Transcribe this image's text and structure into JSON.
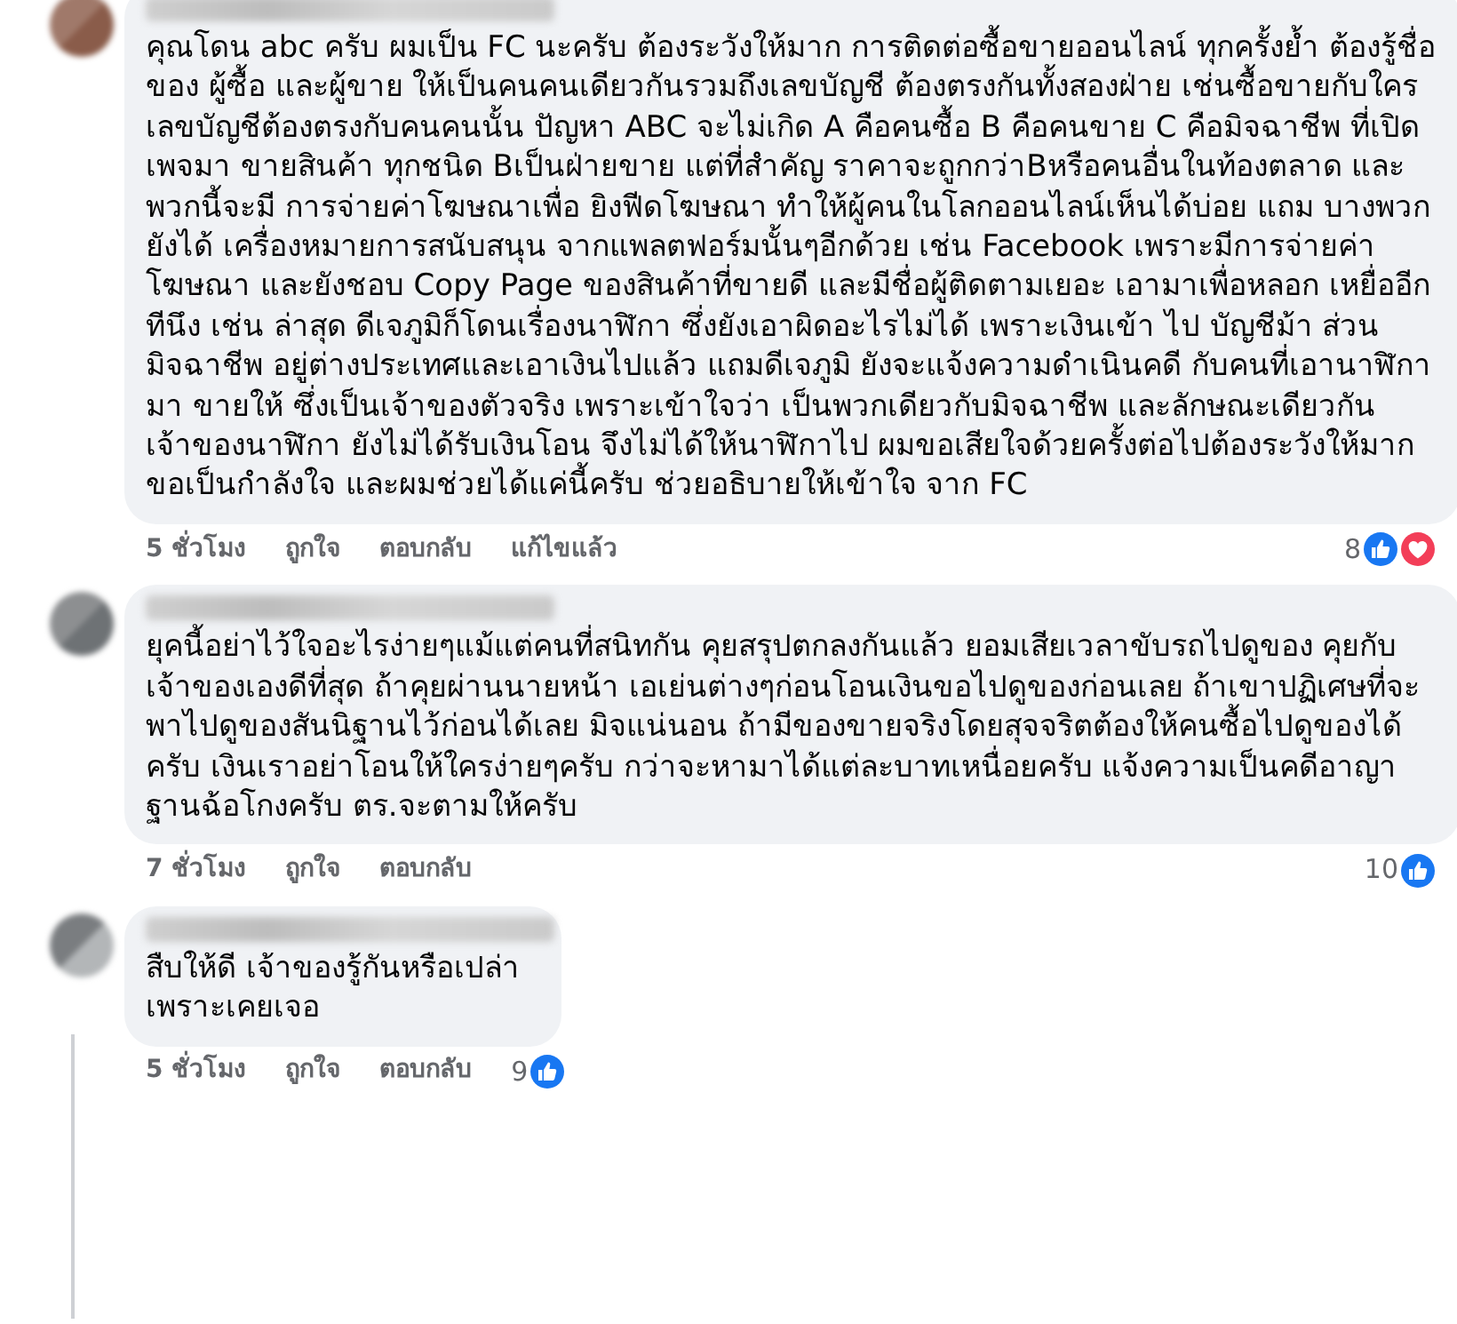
{
  "comments": [
    {
      "reply": false,
      "text": "คุณโดน abc ครับ ผมเป็น FC นะครับ ต้องระวังให้มาก การติดต่อซื้อขายออนไลน์ ทุกครั้งย้ำ ต้องรู้ชื่อของ ผู้ซื้อ และผู้ขาย ให้เป็นคนคนเดียวกันรวมถึงเลขบัญชี ต้องตรงกันทั้งสองฝ่าย เช่นซื้อขายกับใคร เลขบัญชีต้องตรงกับคนคนนั้น ปัญหา ABC จะไม่เกิด A คือคนซื้อ B คือคนขาย C คือมิจฉาชีพ ที่เปิดเพจมา ขายสินค้า ทุกชนิด Bเป็นฝ่ายขาย แต่ที่สำคัญ ราคาจะถูกกว่าBหรือคนอื่นในท้องตลาด และ พวกนี้จะมี การจ่ายค่าโฆษณาเพื่อ ยิงฟีดโฆษณา ทำให้ผู้คนในโลกออนไลน์เห็นได้บ่อย แถม บางพวก ยังได้ เครื่องหมายการสนับสนุน จากแพลตฟอร์มนั้นๆอีกด้วย เช่น Facebook เพราะมีการจ่ายค่าโฆษณา และยังชอบ Copy Page ของสินค้าที่ขายดี และมีชื่อผู้ติดตามเยอะ เอามาเพื่อหลอก เหยื่ออีกทีนึง เช่น ล่าสุด ดีเจภูมิก็โดนเรื่องนาฬิกา ซึ่งยังเอาผิดอะไรไม่ได้ เพราะเงินเข้า ไป บัญชีม้า ส่วนมิจฉาชีพ อยู่ต่างประเทศและเอาเงินไปแล้ว แถมดีเจภูมิ ยังจะแจ้งความดำเนินคดี กับคนที่เอานาฬิกามา ขายให้ ซึ่งเป็นเจ้าของตัวจริง เพราะเข้าใจว่า เป็นพวกเดียวกับมิจฉาชีพ และลักษณะเดียวกัน เจ้าของนาฬิกา ยังไม่ได้รับเงินโอน จึงไม่ได้ให้นาฬิกาไป ผมขอเสียใจด้วยครั้งต่อไปต้องระวังให้มาก ขอเป็นกำลังใจ และผมช่วยได้แค่นี้ครับ ช่วยอธิบายให้เข้าใจ จาก FC",
      "time": "5 ชั่วโมง",
      "actions": [
        "ถูกใจ",
        "ตอบกลับ"
      ],
      "edited": "แก้ไขแล้ว",
      "reaction_count": "8",
      "reactions": [
        {
          "kind": "like"
        },
        {
          "kind": "love"
        }
      ]
    },
    {
      "reply": false,
      "text": "ยุคนี้อย่าไว้ใจอะไรง่ายๆแม้แต่คนที่สนิทกัน คุยสรุปตกลงกันแล้ว ยอมเสียเวลาขับรถไปดูของ คุยกับเจ้าของเองดีที่สุด ถ้าคุยผ่านนายหน้า เอเย่นต่างๆก่อนโอนเงินขอไปดูของก่อนเลย ถ้าเขาปฏิเศษที่จะพาไปดูของสันนิฐานไว้ก่อนได้เลย มิจแน่นอน ถ้ามีของขายจริงโดยสุจจริตต้องให้คนซื้อไปดูของได้ครับ เงินเราอย่าโอนให้ใครง่ายๆครับ กว่าจะหามาได้แต่ละบาทเหนื่อยครับ แจ้งความเป็นคดีอาญาฐานฉ้อโกงครับ ตร.จะตามให้ครับ",
      "time": "7 ชั่วโมง",
      "actions": [
        "ถูกใจ",
        "ตอบกลับ"
      ],
      "reaction_count": "10",
      "reactions": [
        {
          "kind": "like"
        }
      ]
    },
    {
      "reply": true,
      "text": "สืบให้ดี เจ้าของรู้กันหรือเปล่าเพราะเคยเจอ",
      "time": "5 ชั่วโมง",
      "actions": [
        "ถูกใจ",
        "ตอบกลับ"
      ],
      "reaction_count": "9",
      "reactions": [
        {
          "kind": "like"
        }
      ]
    }
  ]
}
